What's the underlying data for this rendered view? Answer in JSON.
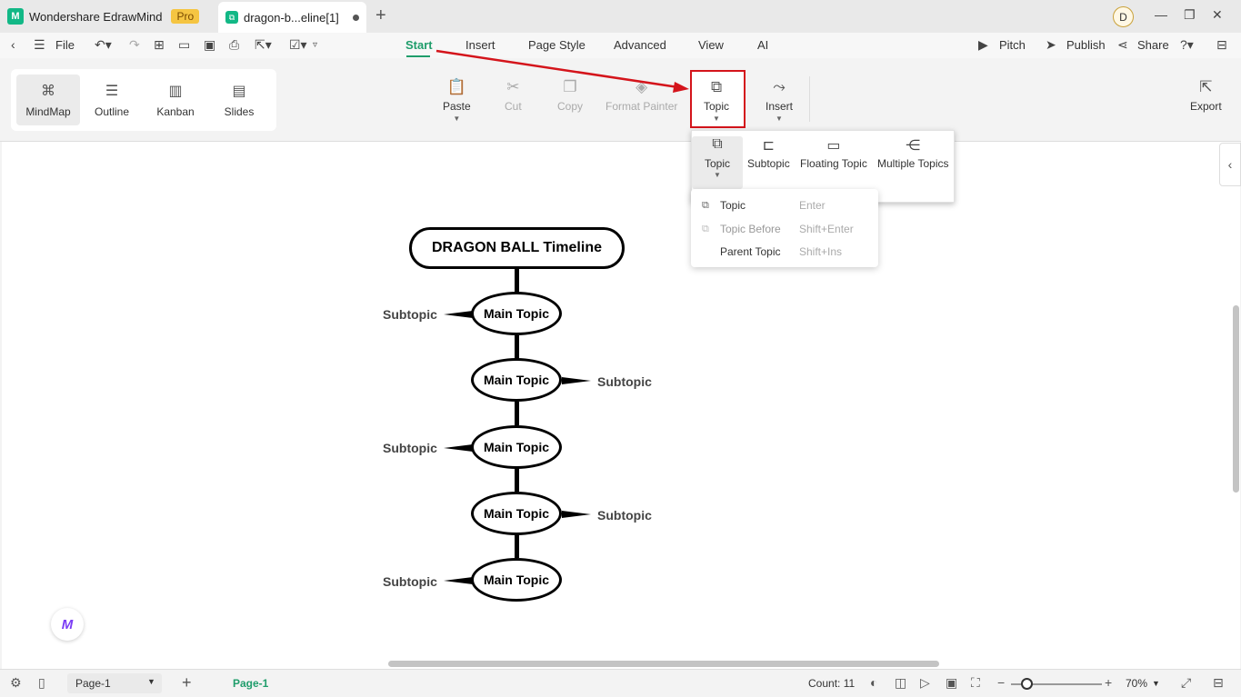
{
  "titlebar": {
    "app_name": "Wondershare EdrawMind",
    "pro_badge": "Pro",
    "doc_tab": "dragon-b...eline[1]",
    "avatar_initial": "D"
  },
  "menubar": {
    "file": "File",
    "tabs": [
      "Start",
      "Insert",
      "Page Style",
      "Advanced",
      "View",
      "AI"
    ],
    "active_tab": "Start",
    "pitch": "Pitch",
    "publish": "Publish",
    "share": "Share"
  },
  "ribbon": {
    "views": [
      "MindMap",
      "Outline",
      "Kanban",
      "Slides"
    ],
    "paste": "Paste",
    "cut": "Cut",
    "copy": "Copy",
    "format_painter": "Format Painter",
    "topic": "Topic",
    "insert": "Insert",
    "export": "Export"
  },
  "dropdown": {
    "items": [
      "Topic",
      "Subtopic",
      "Floating Topic",
      "Multiple Topics"
    ],
    "submenu": [
      {
        "name": "Topic",
        "key": "Enter"
      },
      {
        "name": "Topic Before",
        "key": "Shift+Enter"
      },
      {
        "name": "Parent Topic",
        "key": "Shift+Ins"
      }
    ]
  },
  "mindmap": {
    "root": "DRAGON BALL Timeline",
    "main_topic": "Main Topic",
    "subtopic": "Subtopic"
  },
  "statusbar": {
    "page_select": "Page-1",
    "page_tab": "Page-1",
    "count": "Count: 11",
    "zoom": "70%"
  },
  "colors": {
    "accent": "#1f9d6b",
    "highlight": "#d4141b",
    "pro": "#f5c542"
  }
}
